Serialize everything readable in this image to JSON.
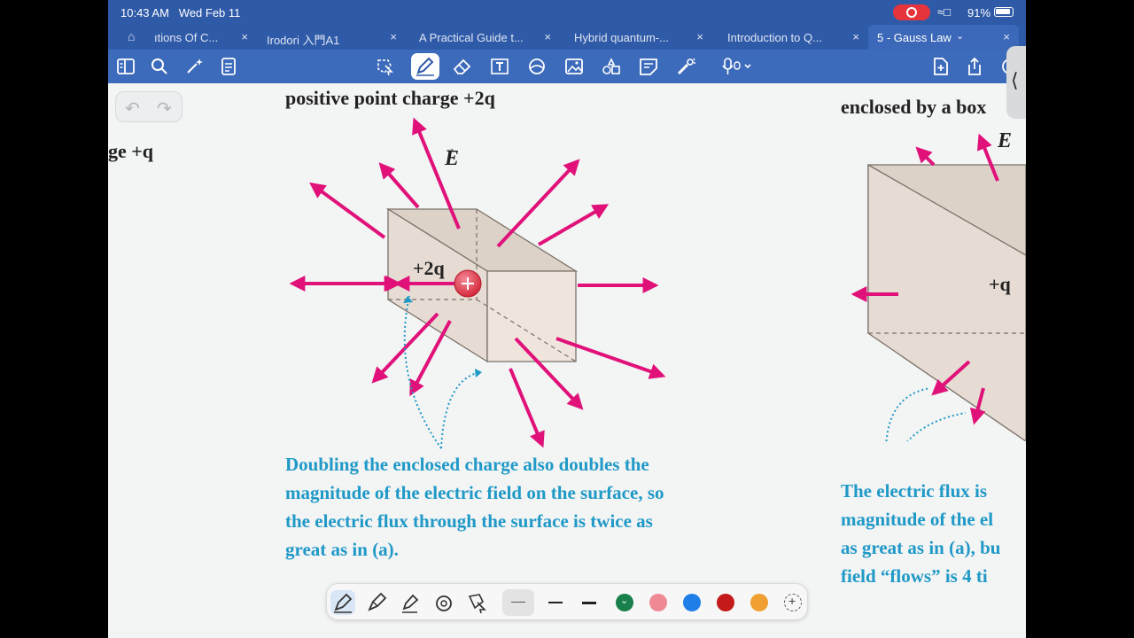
{
  "status": {
    "time": "10:43 AM",
    "date": "Wed Feb 11",
    "battery": "91%"
  },
  "tabs": [
    {
      "label": "ıtions Of C..."
    },
    {
      "label": "Irodori 入門A1"
    },
    {
      "label": "A Practical Guide t..."
    },
    {
      "label": "Hybrid quantum-..."
    },
    {
      "label": "Introduction to Q..."
    },
    {
      "label": "5 - Gauss Law"
    }
  ],
  "toolbar": {
    "tools": [
      "sidebar-icon",
      "search-icon",
      "sparkle-icon",
      "doc-icon",
      "lasso-icon",
      "pen-icon",
      "eraser-icon",
      "text-icon",
      "shapes-icon",
      "image-icon",
      "stickers-icon",
      "note-icon",
      "laser-icon",
      "mic-icon",
      "add-page-icon",
      "share-icon",
      "more-icon"
    ]
  },
  "document": {
    "left_fragment": "ge +q",
    "heading_b": "positive point charge +2q",
    "e_label": "E",
    "charge_label": "+2q",
    "caption_b": [
      "Doubling the enclosed charge also doubles the",
      "magnitude of the electric field on the surface, so",
      "the electric flux through the surface is twice as",
      "great as in (a)."
    ],
    "heading_c": "enclosed by a box",
    "e_label_c": "E",
    "charge_label_c": "+q",
    "caption_c": [
      "The electric flux is",
      "magnitude of the el",
      "as great as in (a), bu",
      "field “flows” is 4 ti"
    ]
  },
  "pen_toolbar": {
    "colors": [
      "#18804a",
      "#ef8a94",
      "#1f7ee8",
      "#c41a1a",
      "#f0a030"
    ]
  },
  "colors": {
    "arrow": "#e0127a",
    "caption": "#1f99c7",
    "chrome": "#2f5aa8"
  }
}
